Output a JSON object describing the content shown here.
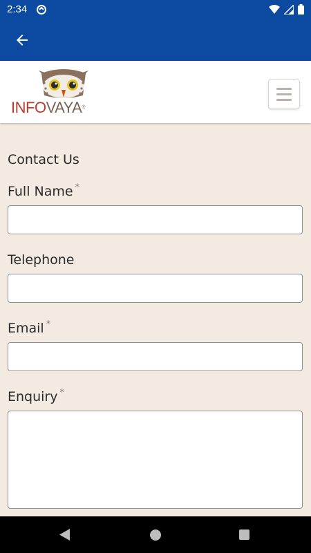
{
  "status_bar": {
    "time": "2:34",
    "icons": [
      "vpn-sync-icon",
      "wifi-icon",
      "cell-signal-icon",
      "battery-icon"
    ]
  },
  "app_bar": {
    "back_icon": "arrow-left-icon"
  },
  "header": {
    "logo_text_info": "INFO",
    "logo_text_vaya": "VAYA",
    "logo_reg": "®",
    "menu_icon": "hamburger-icon"
  },
  "form": {
    "title": "Contact Us",
    "fields": [
      {
        "label": "Full Name",
        "required": true,
        "value": "",
        "placeholder": ""
      },
      {
        "label": "Telephone",
        "required": false,
        "value": "",
        "placeholder": ""
      },
      {
        "label": "Email",
        "required": true,
        "value": "",
        "placeholder": ""
      },
      {
        "label": "Enquiry",
        "required": true,
        "value": "",
        "placeholder": ""
      }
    ],
    "required_mark": "*"
  },
  "nav_bar": {
    "icons": [
      "nav-back-icon",
      "nav-home-icon",
      "nav-recents-icon"
    ]
  },
  "colors": {
    "app_bar": "#0b4aa0",
    "page_bg": "#f3ebe2",
    "logo_red": "#c0392b",
    "logo_brown": "#7a6657"
  }
}
